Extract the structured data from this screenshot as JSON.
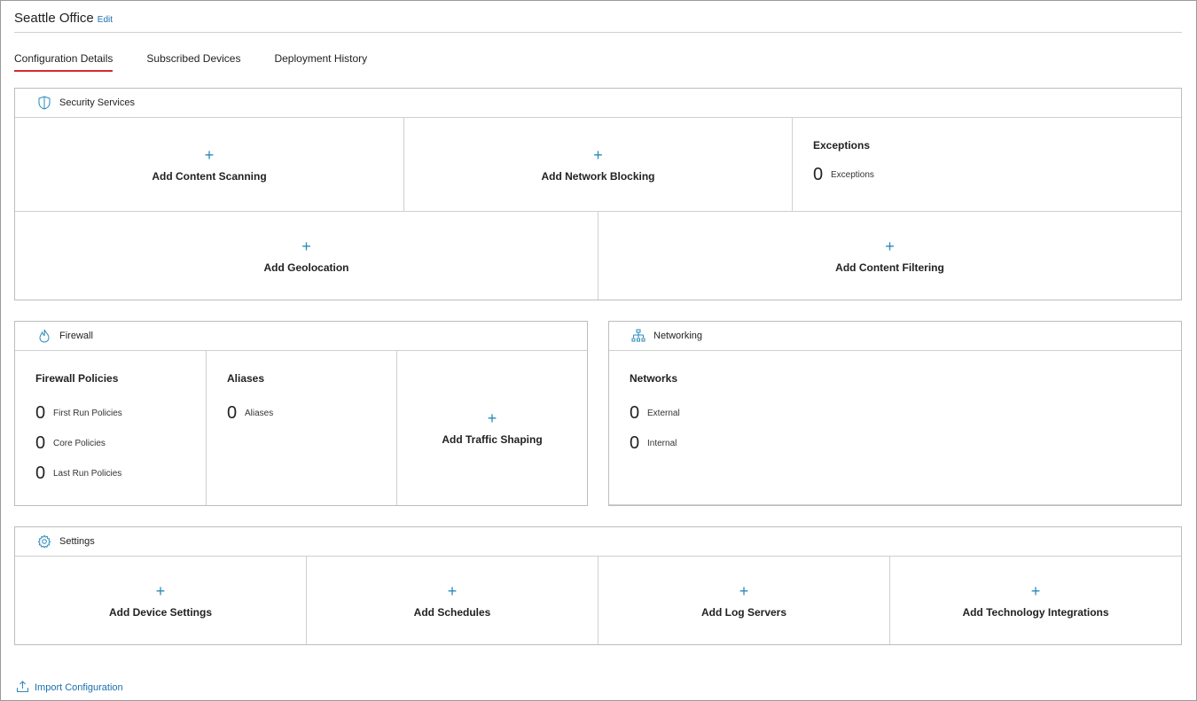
{
  "header": {
    "title": "Seattle Office",
    "edit_label": "Edit"
  },
  "tabs": [
    {
      "label": "Configuration Details",
      "active": true
    },
    {
      "label": "Subscribed Devices",
      "active": false
    },
    {
      "label": "Deployment History",
      "active": false
    }
  ],
  "security": {
    "title": "Security Services",
    "add_content_scanning": "Add Content Scanning",
    "add_network_blocking": "Add Network Blocking",
    "exceptions": {
      "title": "Exceptions",
      "count": "0",
      "label": "Exceptions"
    },
    "add_geolocation": "Add Geolocation",
    "add_content_filtering": "Add Content Filtering"
  },
  "firewall": {
    "title": "Firewall",
    "policies": {
      "title": "Firewall Policies",
      "rows": [
        {
          "count": "0",
          "label": "First Run Policies"
        },
        {
          "count": "0",
          "label": "Core Policies"
        },
        {
          "count": "0",
          "label": "Last Run Policies"
        }
      ]
    },
    "aliases": {
      "title": "Aliases",
      "count": "0",
      "label": "Aliases"
    },
    "add_traffic_shaping": "Add Traffic Shaping"
  },
  "networking": {
    "title": "Networking",
    "networks": {
      "title": "Networks",
      "rows": [
        {
          "count": "0",
          "label": "External"
        },
        {
          "count": "0",
          "label": "Internal"
        }
      ]
    }
  },
  "settings": {
    "title": "Settings",
    "add_device_settings": "Add Device Settings",
    "add_schedules": "Add Schedules",
    "add_log_servers": "Add Log Servers",
    "add_technology_integrations": "Add Technology Integrations"
  },
  "import": {
    "label": "Import Configuration"
  },
  "icons": {
    "plus": "+",
    "security": "shield-icon",
    "firewall": "flame-icon",
    "networking": "network-icon",
    "settings": "gear-icon",
    "import": "upload-icon"
  },
  "colors": {
    "accent": "#1a6fb0",
    "plus": "#2a8ab8",
    "active_tab": "#d62b2b"
  }
}
